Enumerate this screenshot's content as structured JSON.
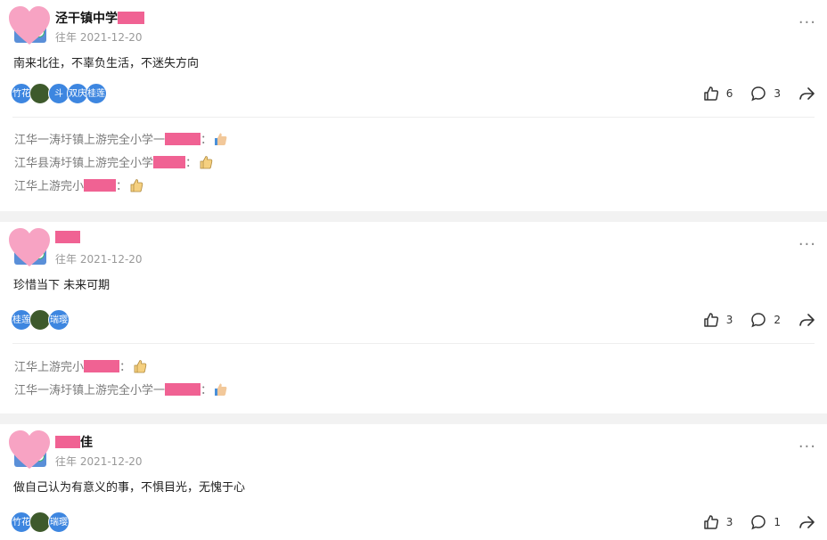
{
  "posts": [
    {
      "author": "泾干镇中学",
      "time": "往年 2021-12-20",
      "content": "南来北往，不辜负生活，不迷失方向",
      "likers": [
        "竹花",
        "",
        "斗",
        "双庆",
        "桂莲"
      ],
      "likes": "6",
      "comments_count": "3",
      "comments": [
        {
          "prefix": "江华一涛圩镇上游完全小学一",
          "suffix": "："
        },
        {
          "prefix": "江华县涛圩镇上游完全小学",
          "suffix": "："
        },
        {
          "prefix": "江华上游完小",
          "suffix": "："
        }
      ]
    },
    {
      "author": "",
      "time": "往年 2021-12-20",
      "content": "珍惜当下  未来可期",
      "likers": [
        "桂莲",
        "",
        "瑞璎"
      ],
      "likes": "3",
      "comments_count": "2",
      "comments": [
        {
          "prefix": "江华上游完小",
          "suffix": "："
        },
        {
          "prefix": "江华一涛圩镇上游完全小学一",
          "suffix": "："
        }
      ]
    },
    {
      "author": "佳",
      "time": "往年 2021-12-20",
      "content": "做自己认为有意义的事，不惧目光，无愧于心",
      "likers": [
        "竹花",
        "",
        "瑞璎"
      ],
      "likes": "3",
      "comments_count": "1",
      "comments": []
    }
  ],
  "icons": {
    "like": "thumbs-up-icon",
    "comment": "comment-bubble-icon",
    "share": "share-arrow-icon",
    "more": "more-dots-icon"
  },
  "colors": {
    "redaction": "#f06293",
    "avatar_blue": "#3d86e0",
    "comment_grey": "#7b7b7b"
  }
}
